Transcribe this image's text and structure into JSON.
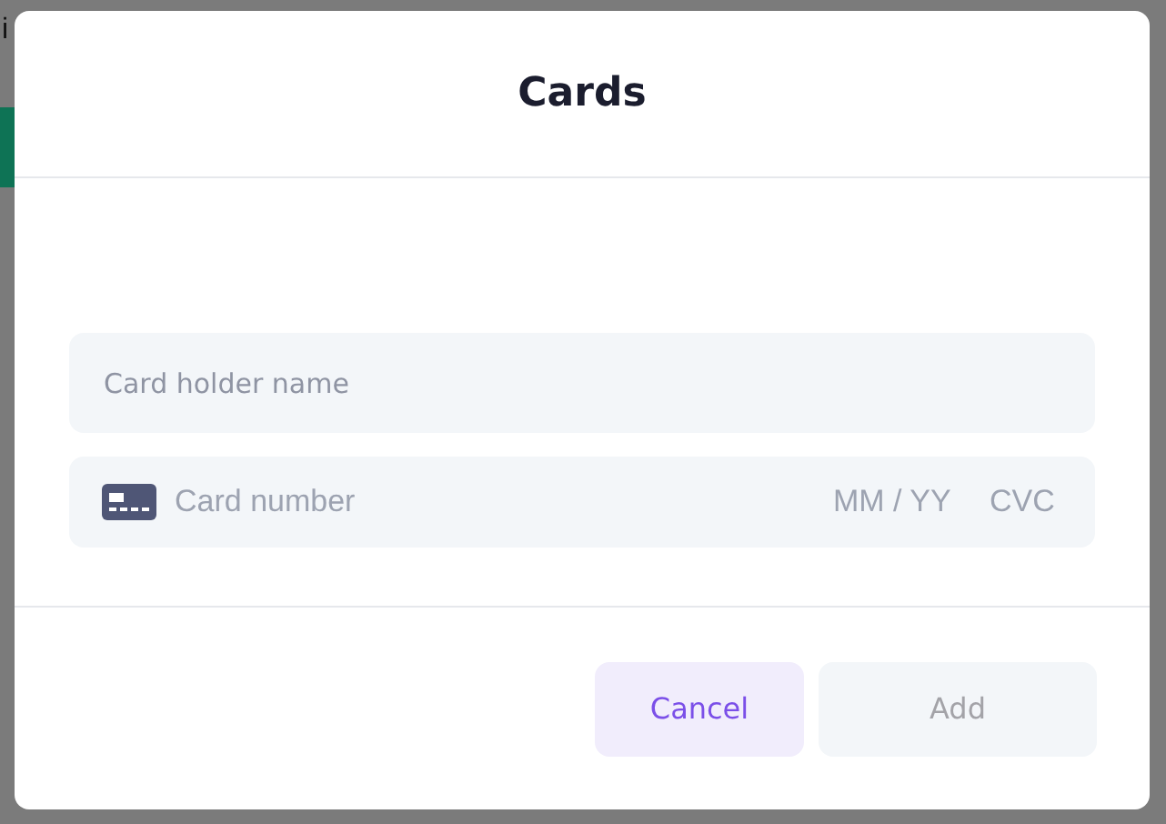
{
  "background": {
    "text": "i"
  },
  "dialog": {
    "title": "Cards",
    "fields": [
      {
        "kind": "text",
        "placeholder": "Card holder name"
      },
      {
        "kind": "card",
        "placeholder": "Card number",
        "expiry_placeholder": "MM / YY",
        "cvc_placeholder": "CVC"
      }
    ],
    "buttons": [
      {
        "kind": "cancel",
        "label": "Cancel",
        "disabled": false
      },
      {
        "kind": "add",
        "label": "Add",
        "disabled": true
      }
    ]
  }
}
